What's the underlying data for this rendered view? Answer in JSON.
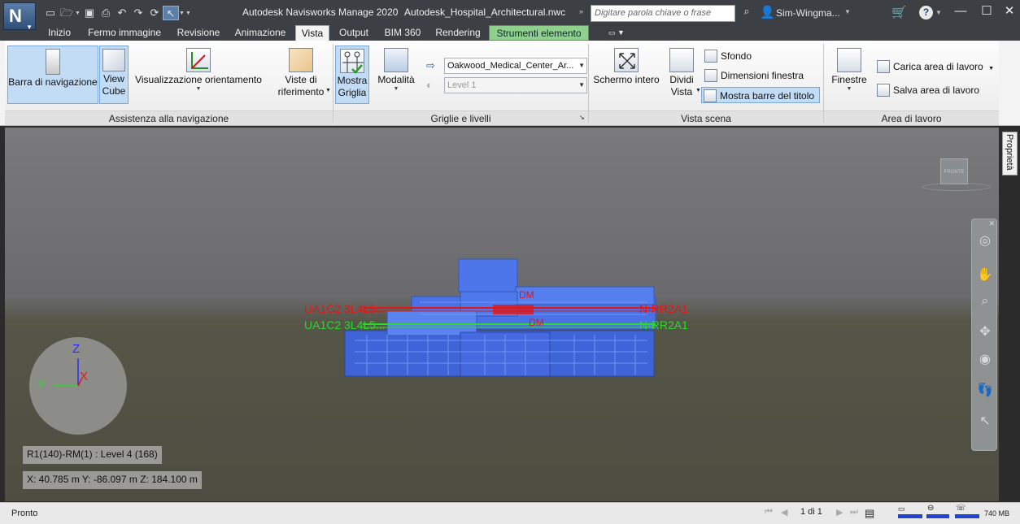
{
  "titlebar": {
    "app_letter": "N",
    "app_title": "Autodesk Navisworks Manage 2020",
    "file_name": "Autodesk_Hospital_Architectural.nwc",
    "search_placeholder": "Digitare parola chiave o frase",
    "user_name": "Sim-Wingma...",
    "minimize": "—",
    "maximize": "☐",
    "close": "✕"
  },
  "tabs": [
    "Inizio",
    "Fermo immagine",
    "Revisione",
    "Animazione",
    "Vista",
    "Output",
    "BIM 360",
    "Rendering",
    "Strumenti elemento"
  ],
  "active_tab": "Vista",
  "ribbon": {
    "nav_assist": {
      "title": "Assistenza alla navigazione",
      "nav_bar": "Barra di navigazione",
      "viewcube_1": "View",
      "viewcube_2": "Cube",
      "orientation": "Visualizzazione orientamento",
      "ref_views_1": "Viste di",
      "ref_views_2": "riferimento"
    },
    "grids": {
      "title": "Griglie e livelli",
      "show_grid_1": "Mostra",
      "show_grid_2": "Griglia",
      "mode": "Modalità",
      "model_combo": "Oakwood_Medical_Center_Ar...",
      "level_combo": "Level 1"
    },
    "scene_view": {
      "title": "Vista scena",
      "fullscreen": "Schermo intero",
      "split_1": "Dividi",
      "split_2": "Vista",
      "background": "Sfondo",
      "window_size": "Dimensioni finestra",
      "show_titlebars": "Mostra barre del titolo"
    },
    "workspace": {
      "title": "Area di lavoro",
      "windows": "Finestre",
      "load_workspace": "Carica area di lavoro",
      "save_workspace": "Salva area di lavoro"
    }
  },
  "viewport": {
    "axis_z": "Z",
    "axis_y": "Y",
    "axis_x": "X",
    "info_location": "R1(140)-RM(1) : Level 4 (168)",
    "info_coords": "X: 40.785 m  Y: -86.097 m  Z: 184.100 m",
    "viewcube_face": "FRONTE",
    "grid_label_left_red": "UA1C2 3L4L5...",
    "grid_label_left_green": "UA1C2 3L4L5...",
    "grid_label_right_red": "N-RR2A1",
    "grid_label_right_green": "N-RR2A1",
    "grid_label_dm": "DM"
  },
  "properties_tab": "Proprietà",
  "statusbar": {
    "status": "Pronto",
    "page": "1 di 1",
    "memory": "740 MB"
  },
  "colors": {
    "building": "#4a72e6",
    "grid_red": "#e01818",
    "grid_green": "#2fd62f",
    "accent": "#c2dcf5"
  }
}
